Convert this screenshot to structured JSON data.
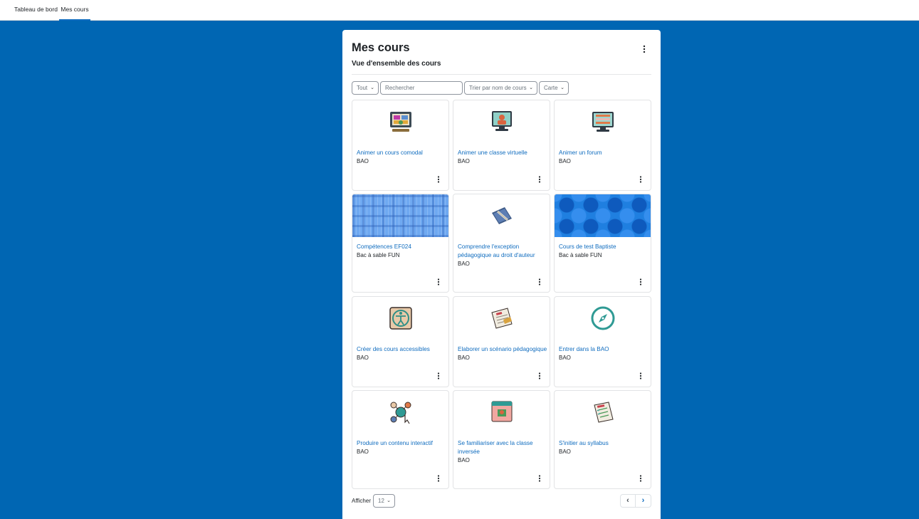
{
  "nav": {
    "items": [
      {
        "label": "Tableau de bord",
        "active": false
      },
      {
        "label": "Mes cours",
        "active": true
      }
    ]
  },
  "header": {
    "title": "Mes cours",
    "subtitle": "Vue d'ensemble des cours",
    "menu_icon": "kebab-menu-icon"
  },
  "filters": {
    "grouping_label": "Tout",
    "search_placeholder": "Rechercher",
    "sort_label": "Trier par nom de cours",
    "view_label": "Carte",
    "chevron": "⌄"
  },
  "courses": [
    {
      "title": "Animer un cours comodal",
      "category": "BAO",
      "image": "comodal-illustration"
    },
    {
      "title": "Animer une classe virtuelle",
      "category": "BAO",
      "image": "virtual-class-illustration"
    },
    {
      "title": "Animer un forum",
      "category": "BAO",
      "image": "forum-illustration"
    },
    {
      "title": "Compétences EF024",
      "category": "Bac à sable FUN",
      "image": "plaid-pattern"
    },
    {
      "title": "Comprendre l'exception pédagogique au droit d'auteur",
      "category": "BAO",
      "image": "book-quill-illustration"
    },
    {
      "title": "Cours de test Baptiste",
      "category": "Bac à sable FUN",
      "image": "dot-pattern"
    },
    {
      "title": "Créer des cours accessibles",
      "category": "BAO",
      "image": "accessibility-illustration"
    },
    {
      "title": "Elaborer un scénario pédagogique",
      "category": "BAO",
      "image": "scenario-document-illustration"
    },
    {
      "title": "Entrer dans la BAO",
      "category": "BAO",
      "image": "compass-illustration"
    },
    {
      "title": "Produire un contenu interactif",
      "category": "BAO",
      "image": "interactive-content-illustration"
    },
    {
      "title": "Se familiariser avec la classe inversée",
      "category": "BAO",
      "image": "flipped-class-illustration"
    },
    {
      "title": "S'initier au syllabus",
      "category": "BAO",
      "image": "syllabus-illustration"
    }
  ],
  "footer": {
    "show_label": "Afficher",
    "per_page": "12",
    "prev_icon": "‹",
    "next_icon": "›"
  },
  "colors": {
    "background": "#0066b3",
    "link": "#0f6cbf",
    "text": "#1d2125"
  }
}
